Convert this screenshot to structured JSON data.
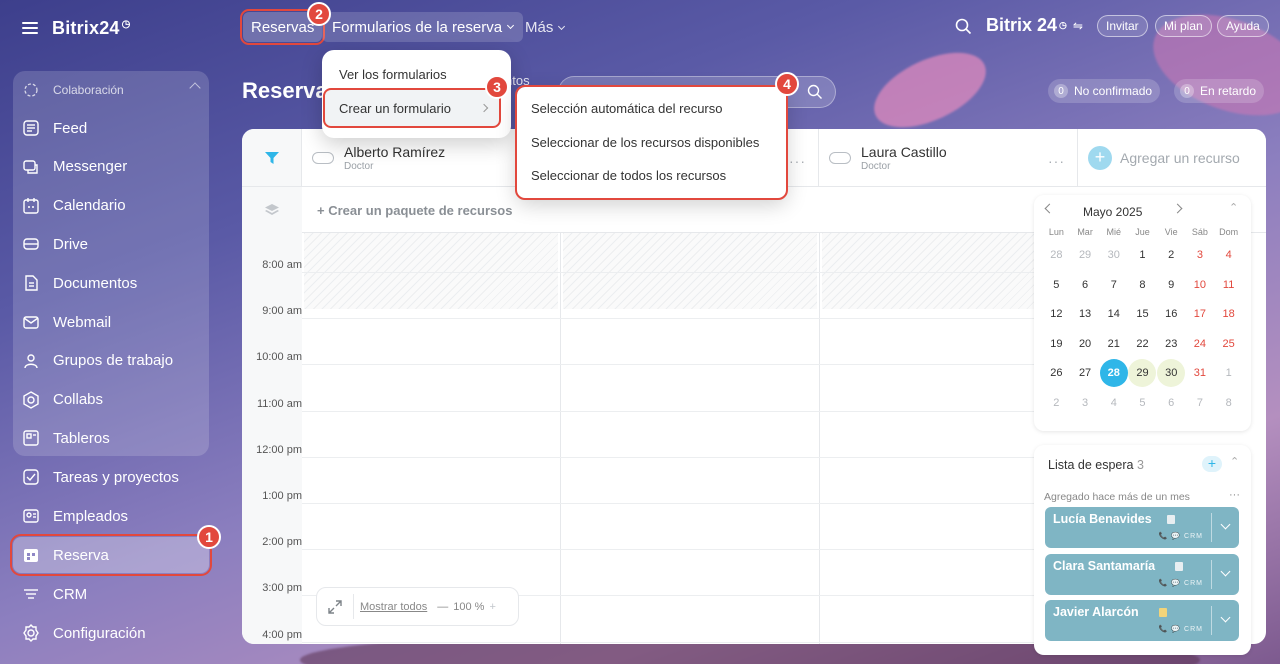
{
  "app": {
    "brand": "Bitrix24",
    "brand_badge": "◷"
  },
  "sidebar": {
    "group_label": "Colaboración",
    "group_items": [
      {
        "label": "Feed",
        "icon": "feed-icon"
      },
      {
        "label": "Messenger",
        "icon": "messenger-icon"
      },
      {
        "label": "Calendario",
        "icon": "calendar-icon"
      },
      {
        "label": "Drive",
        "icon": "drive-icon"
      },
      {
        "label": "Documentos",
        "icon": "documents-icon"
      },
      {
        "label": "Webmail",
        "icon": "webmail-icon"
      },
      {
        "label": "Grupos de trabajo",
        "icon": "workgroups-icon"
      },
      {
        "label": "Collabs",
        "icon": "collabs-icon"
      },
      {
        "label": "Tableros",
        "icon": "boards-icon"
      }
    ],
    "items": [
      {
        "label": "Tareas y proyectos",
        "icon": "tasks-icon"
      },
      {
        "label": "Empleados",
        "icon": "employees-icon"
      },
      {
        "label": "Reserva",
        "icon": "booking-icon"
      },
      {
        "label": "CRM",
        "icon": "crm-icon"
      },
      {
        "label": "Configuración",
        "icon": "settings-icon"
      }
    ]
  },
  "topbar": {
    "tab_reservas": "Reservas",
    "tab_formularios": "Formularios de la reserva",
    "tab_mas": "Más",
    "brand_right": "Bitrix 24",
    "invite": "Invitar",
    "plan": "Mi plan",
    "help": "Ayuda"
  },
  "page": {
    "title": "Reserva",
    "title_partial_behind": "ntos",
    "counter_unconfirmed_value": "0",
    "counter_unconfirmed_label": "No confirmado",
    "counter_late_value": "0",
    "counter_late_label": "En retardo"
  },
  "resources": [
    {
      "name": "Alberto Ramírez",
      "role": "Doctor"
    },
    {
      "name": "Laura Castillo",
      "role": "Doctor"
    }
  ],
  "add_resource": "Agregar un recurso",
  "create_package": "+ Crear un paquete de recursos",
  "times": [
    "8:00 am",
    "9:00 am",
    "10:00 am",
    "11:00 am",
    "12:00 pm",
    "1:00 pm",
    "2:00 pm",
    "3:00 pm",
    "4:00 pm"
  ],
  "zoom": {
    "show_all": "Mostrar todos",
    "level": "100 %",
    "minus": "—",
    "plus": "+"
  },
  "calendar": {
    "month": "Mayo 2025",
    "weekdays": [
      "Lun",
      "Mar",
      "Mié",
      "Jue",
      "Vie",
      "Sáb",
      "Dom"
    ],
    "weeks": [
      [
        "28",
        "29",
        "30",
        "1",
        "2",
        "3",
        "4"
      ],
      [
        "5",
        "6",
        "7",
        "8",
        "9",
        "10",
        "11"
      ],
      [
        "12",
        "13",
        "14",
        "15",
        "16",
        "17",
        "18"
      ],
      [
        "19",
        "20",
        "21",
        "22",
        "23",
        "24",
        "25"
      ],
      [
        "26",
        "27",
        "28",
        "29",
        "30",
        "31",
        "1"
      ],
      [
        "2",
        "3",
        "4",
        "5",
        "6",
        "7",
        "8"
      ]
    ],
    "selected": "28",
    "highlighted": [
      "29",
      "30"
    ]
  },
  "waitlist": {
    "title": "Lista de espera",
    "count": "3",
    "subtitle": "Agregado hace más de un mes",
    "items": [
      {
        "name": "Lucía Benavides"
      },
      {
        "name": "Clara Santamaría"
      },
      {
        "name": "Javier Alarcón"
      }
    ],
    "crm_tag": "CRM"
  },
  "menu": {
    "view_forms": "Ver los formularios",
    "create_form": "Crear un formulario",
    "submenu": [
      "Selección automática del recurso",
      "Seleccionar de los recursos disponibles",
      "Seleccionar de todos los recursos"
    ]
  },
  "steps": [
    "1",
    "2",
    "3",
    "4"
  ],
  "colors": {
    "accent": "#2fb6e8",
    "highlight": "#e2483d",
    "waitlist_card": "#7fb5c4"
  }
}
